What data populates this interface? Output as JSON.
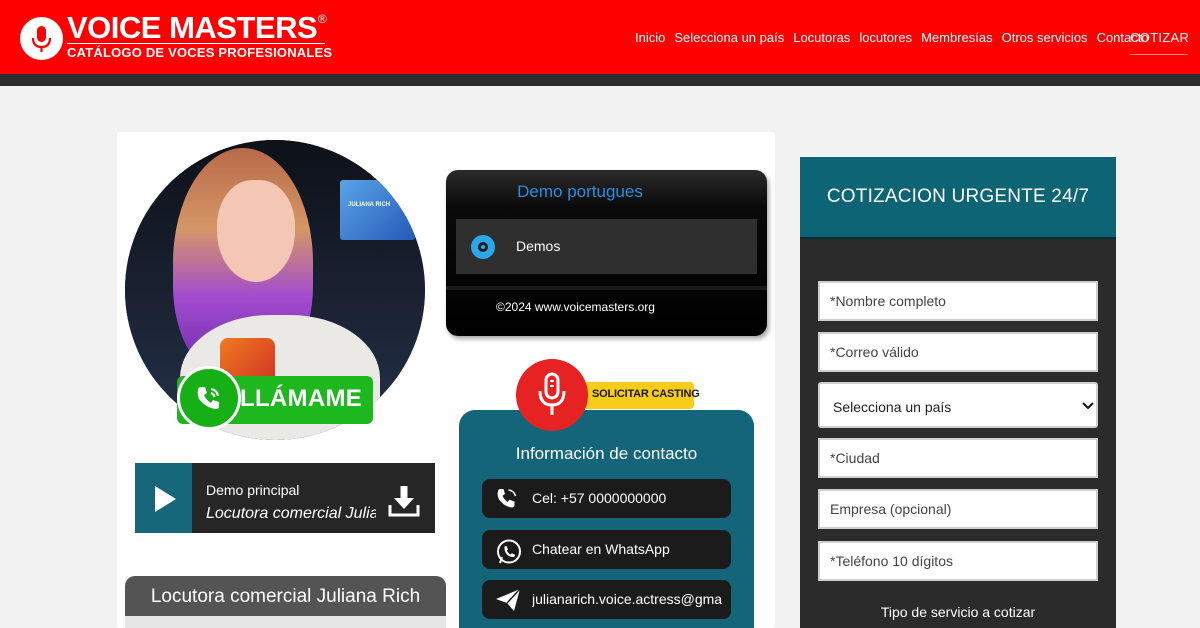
{
  "brand": {
    "title": "VOICE MASTERS",
    "registered": "®",
    "subtitle": "CATÁLOGO DE VOCES PROFESIONALES"
  },
  "nav": {
    "items": [
      {
        "label": "Inicio"
      },
      {
        "label": "Selecciona un país"
      },
      {
        "label": "Locutoras"
      },
      {
        "label": "locutores"
      },
      {
        "label": "Membresías"
      },
      {
        "label": "Otros servicios"
      },
      {
        "label": "Contacto"
      }
    ],
    "cta": "COTIZAR"
  },
  "profile": {
    "call_label": "LLÁMAME",
    "photo_sign": "JULIANA RICH",
    "name": "Locutora comercial Juliana Rich"
  },
  "main_demo": {
    "title": "Demo principal",
    "subtitle": "Locutora comercial Juliana Rich"
  },
  "player": {
    "title": "Demo portugues",
    "track": "Demos",
    "copyright": "©2024 www.voicemasters.org"
  },
  "casting": {
    "label": "SOLICITAR CASTING"
  },
  "contact": {
    "title": "Información de contacto",
    "phone": "Cel: +57 0000000000",
    "whatsapp": "Chatear en WhatsApp",
    "email": "julianarich.voice.actress@gmail.com"
  },
  "quote_form": {
    "title": "COTIZACION URGENTE 24/7",
    "name_placeholder": "*Nombre completo",
    "email_placeholder": "*Correo válido",
    "country_select": "Selecciona un país",
    "city_placeholder": "*Ciudad",
    "company_placeholder": "Empresa (opcional)",
    "phone_placeholder": "*Teléfono 10 dígitos",
    "service_label": "Tipo de servicio a cotizar"
  },
  "colors": {
    "brand_red": "#fe0000",
    "teal": "#14647a",
    "call_green": "#1db81d",
    "casting_yellow": "#f8cd19"
  }
}
